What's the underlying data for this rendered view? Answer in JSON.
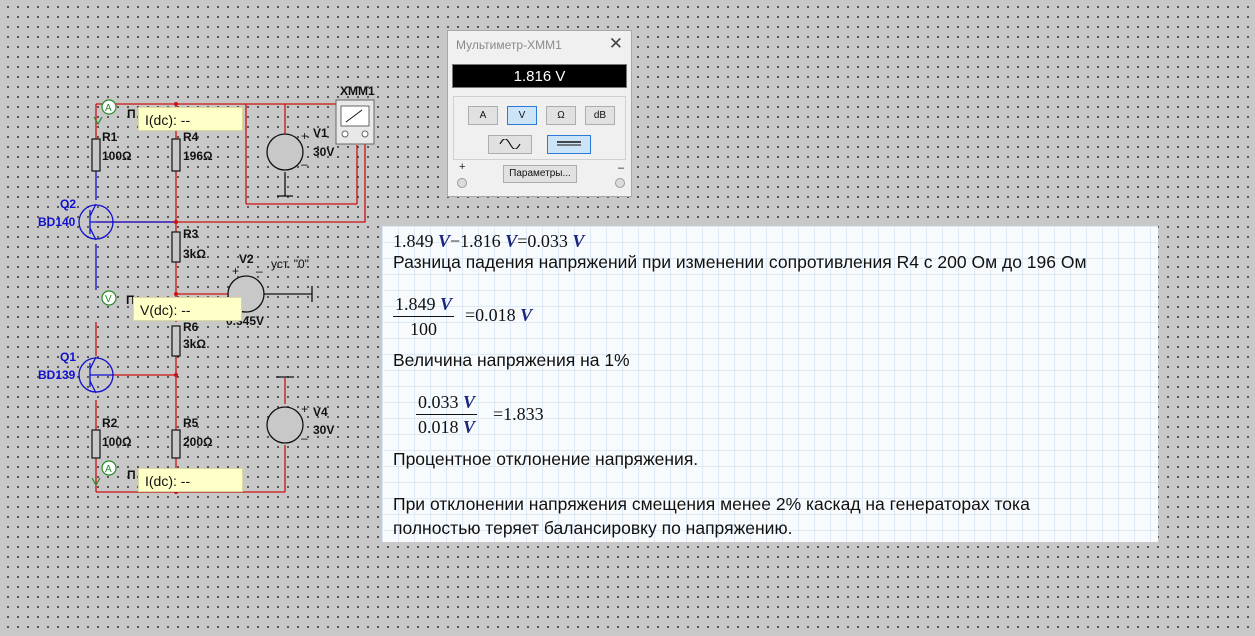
{
  "schematic": {
    "r1": {
      "name": "R1",
      "value": "100Ω"
    },
    "r4": {
      "name": "R4",
      "value": "196Ω"
    },
    "r3": {
      "name": "R3",
      "value": "3kΩ"
    },
    "r6": {
      "name": "R6",
      "value": "3kΩ"
    },
    "r2": {
      "name": "R2",
      "value": "100Ω"
    },
    "r5": {
      "name": "R5",
      "value": "200Ω"
    },
    "q2": {
      "name": "Q2",
      "model": "BD140"
    },
    "q1": {
      "name": "Q1",
      "model": "BD139"
    },
    "v1": {
      "name": "V1",
      "value": "30V"
    },
    "v4": {
      "name": "V4",
      "value": "30V"
    },
    "v2": {
      "name": "V2",
      "setting": "уст. \"0\"",
      "value": "0.345V"
    },
    "xmm_label": "XMM1",
    "probe_letter_current": "A",
    "probe_letter_voltage": "V",
    "probe_tag": "П",
    "probes": {
      "top": "I(dc): --",
      "middle": "V(dc): --",
      "bottom": "I(dc): --"
    }
  },
  "multimeter": {
    "title": "Мультиметр-XMM1",
    "close": "✕",
    "reading": "1.816 V",
    "modes": [
      "A",
      "V",
      "Ω",
      "dB"
    ],
    "selected_mode": "V",
    "coupling_selected": "dc",
    "params_label": "Параметры...",
    "plus": "+",
    "minus": "–"
  },
  "notes": {
    "eq1": {
      "a": "1.849",
      "b": "1.816",
      "c": "0.033",
      "unit": "V",
      "minus": "−",
      "eq": "="
    },
    "line1": "Разница падения напряжений при изменении сопротивления R4 с 200 Ом до 196 Ом",
    "eq2": {
      "num": "1.849",
      "unit": "V",
      "den": "100",
      "result": "0.018"
    },
    "line2": "Величина напряжения на 1%",
    "eq3": {
      "num": "0.033",
      "den": "0.018",
      "unit": "V",
      "result": "1.833"
    },
    "line3": "Процентное отклонение напряжения.",
    "line4a": "При отклонении напряжения смещения менее 2% каскад на генераторах тока",
    "line4b": "полностью теряет балансировку по напряжению."
  },
  "colors": {
    "wire_red": "#cc1111",
    "wire_blue": "#1010d0",
    "wire_black": "#111111",
    "probe_bg": "#ffffc8"
  }
}
